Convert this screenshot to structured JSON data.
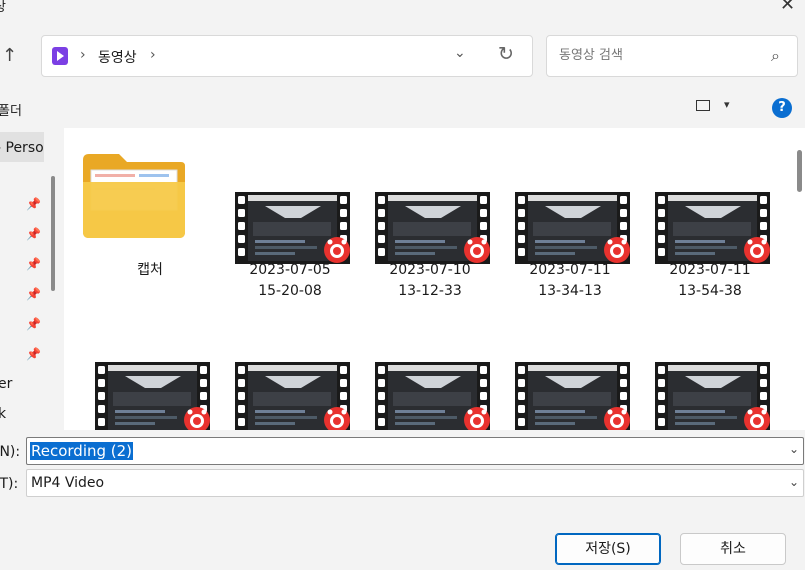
{
  "window": {
    "title": "상",
    "close_glyph": "✕"
  },
  "nav": {
    "up_glyph": "↑",
    "breadcrumb": [
      "동영상"
    ],
    "separator": "›",
    "dropdown_glyph": "⌄",
    "refresh_glyph": "↻"
  },
  "search": {
    "placeholder": "동영상 검색",
    "icon": "search-icon"
  },
  "toolbar": {
    "new_folder_label": "폴더",
    "view_dropdown_glyph": "▾",
    "help_label": "?"
  },
  "nav_pane": {
    "personal_label": "- Perso",
    "pin_glyph": "📌",
    "items": [
      "er",
      "k"
    ]
  },
  "files": [
    {
      "name": "캡처",
      "kind": "folder"
    },
    {
      "name": "2023-07-05\n15-20-08",
      "kind": "video"
    },
    {
      "name": "2023-07-10\n13-12-33",
      "kind": "video"
    },
    {
      "name": "2023-07-11\n13-34-13",
      "kind": "video"
    },
    {
      "name": "2023-07-11\n13-54-38",
      "kind": "video"
    },
    {
      "name": "",
      "kind": "video"
    },
    {
      "name": "",
      "kind": "video"
    },
    {
      "name": "",
      "kind": "video"
    },
    {
      "name": "",
      "kind": "video"
    },
    {
      "name": "",
      "kind": "video"
    }
  ],
  "form": {
    "filename_label": "(N):",
    "filename_value": "Recording (2)",
    "filetype_label": "(T):",
    "filetype_value": "MP4 Video",
    "dropdown_glyph": "⌄"
  },
  "buttons": {
    "save_label": "저장(S)",
    "cancel_label": "취소"
  },
  "colors": {
    "accent": "#0a6ed1",
    "badge": "#e8322e",
    "folder": "#f5c342"
  }
}
